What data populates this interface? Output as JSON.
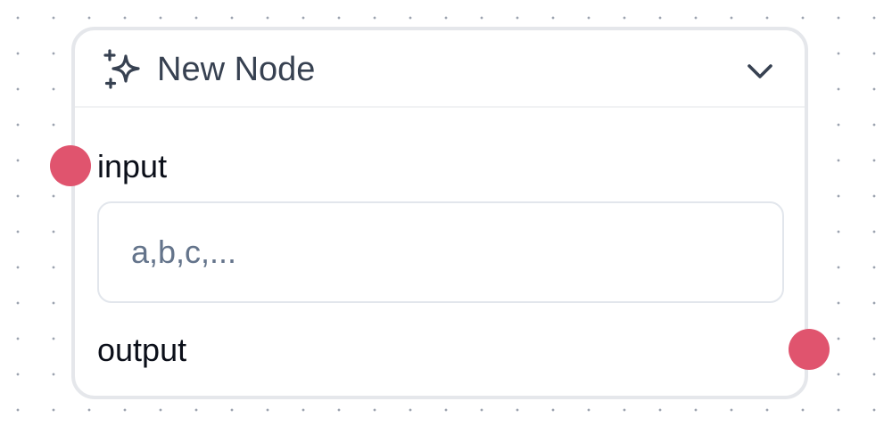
{
  "node": {
    "title": "New Node",
    "header_icon": "sparkles-icon",
    "collapse_icon": "chevron-down-icon",
    "input": {
      "label": "input",
      "placeholder": "a,b,c,...",
      "value": ""
    },
    "output": {
      "label": "output"
    }
  },
  "colors": {
    "handle": "#e0546e",
    "node_border": "#e5e7eb",
    "title_text": "#374151",
    "placeholder_text": "#64748b",
    "canvas_dot": "#9ca3af"
  }
}
